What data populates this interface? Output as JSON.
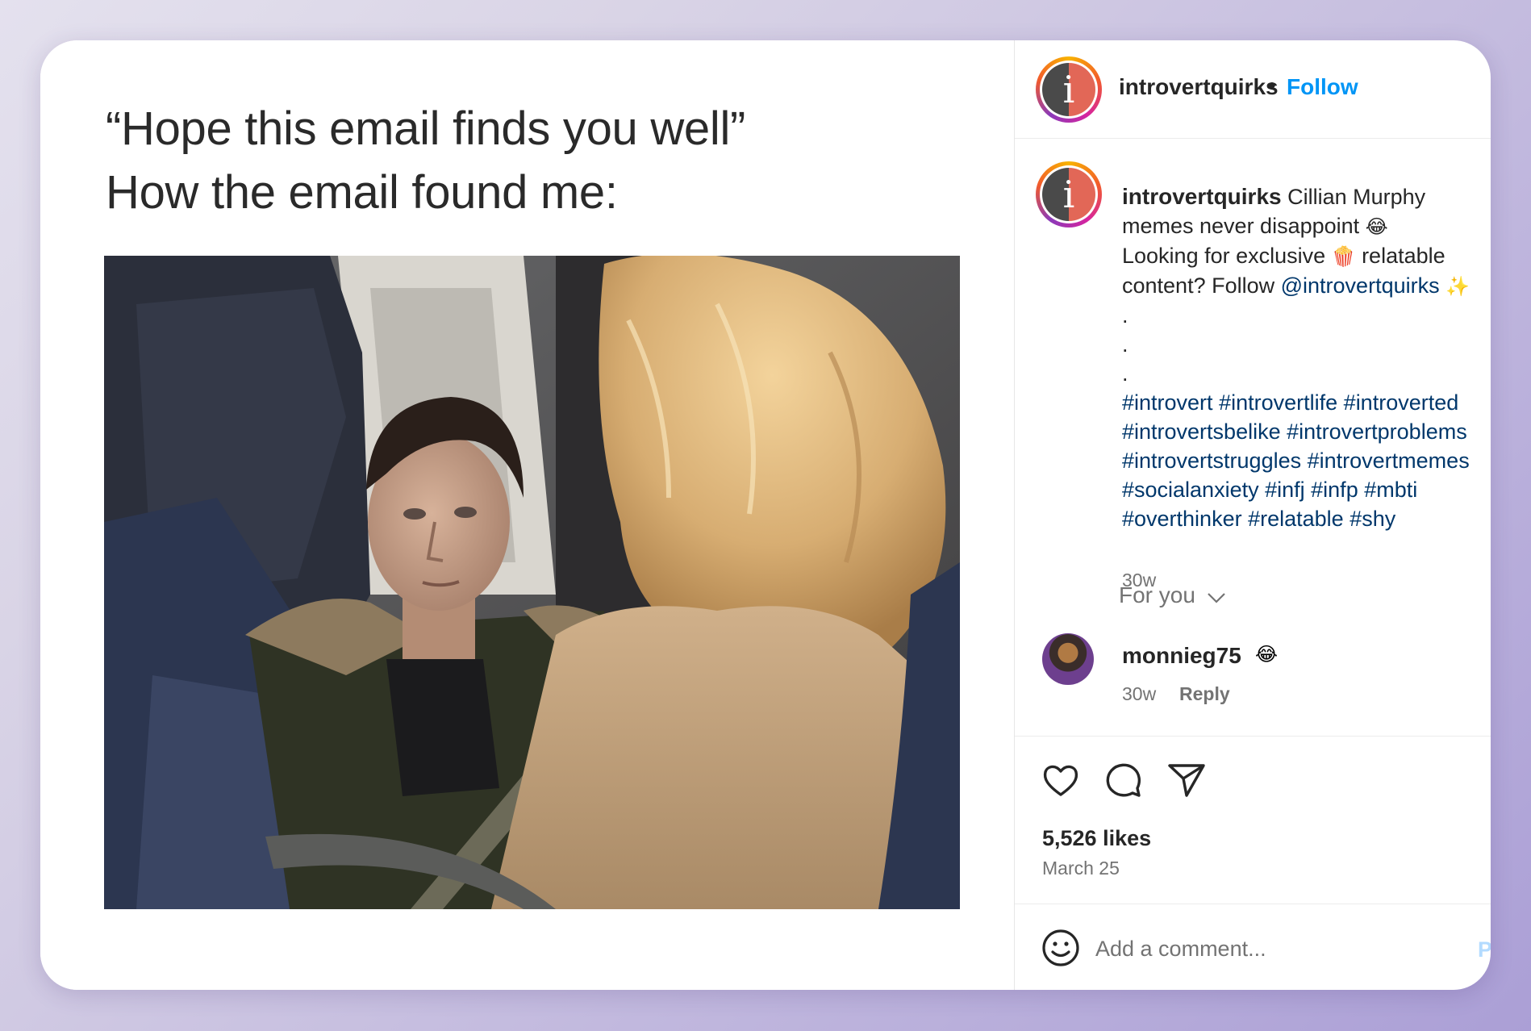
{
  "meme": {
    "line1": "“Hope this email finds you well”",
    "line2": "How the email found me:"
  },
  "header": {
    "username": "introvertquirks",
    "separator": "•",
    "follow_label": "Follow",
    "avatar_letter": "i"
  },
  "caption": {
    "username": "introvertquirks",
    "text_part1": "Cillian Murphy",
    "text_part2": "memes never disappoint",
    "emoji_laugh": "😂",
    "text_part3": "Looking for exclusive",
    "emoji_popcorn": "🍿",
    "text_part4": "relatable",
    "text_part5": "content? Follow",
    "mention": "@introvertquirks",
    "emoji_sparkle": "✨",
    "dots": [
      ".",
      ".",
      "."
    ],
    "hashtags": [
      [
        "#introvert",
        "#introvertlife",
        "#introverted"
      ],
      [
        "#introvertsbelike",
        "#introvertproblems"
      ],
      [
        "#introvertstruggles",
        "#introvertmemes"
      ],
      [
        "#socialanxiety",
        "#infj",
        "#infp",
        "#mbti"
      ],
      [
        "#overthinker",
        "#relatable",
        "#shy"
      ]
    ],
    "time": "30w"
  },
  "comments_filter": {
    "label": "For you"
  },
  "comment": {
    "username": "monnieg75",
    "emoji": "😂",
    "time": "30w",
    "reply_label": "Reply"
  },
  "actions": {
    "icons": [
      "heart-icon",
      "comment-icon",
      "share-icon"
    ]
  },
  "stats": {
    "likes": "5,526 likes",
    "date": "March 25"
  },
  "add_comment": {
    "placeholder": "Add a comment...",
    "post_label": "Post"
  },
  "colors": {
    "accent": "#0095f6",
    "hashtag": "#00376b",
    "muted": "#737373",
    "text": "#262626"
  }
}
